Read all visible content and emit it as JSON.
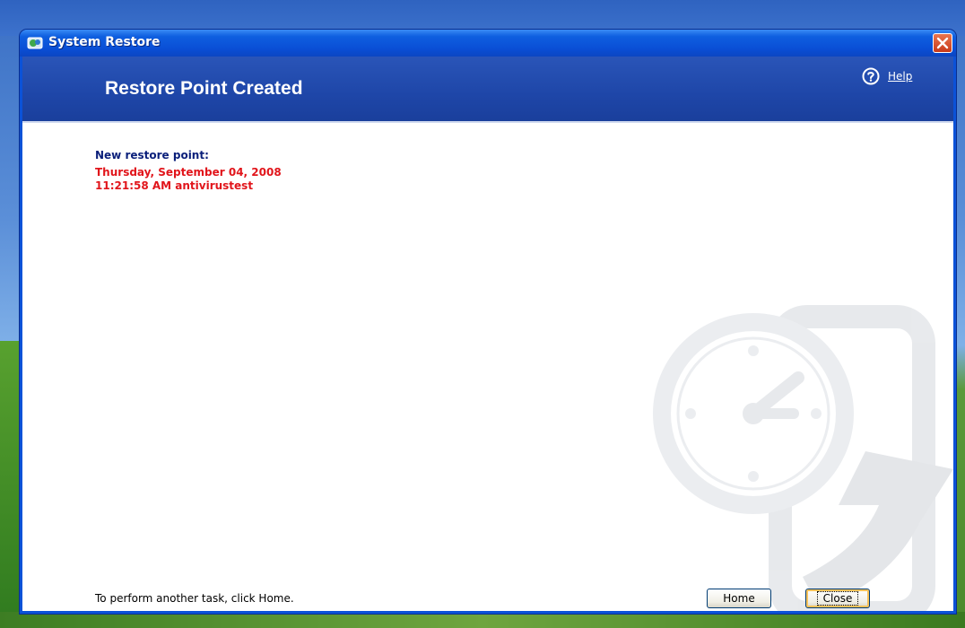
{
  "window": {
    "title": "System Restore"
  },
  "header": {
    "title": "Restore Point Created",
    "help_label": "Help"
  },
  "content": {
    "new_point_label": "New restore point:",
    "restore_date": "Thursday, September 04, 2008",
    "restore_time_desc": "11:21:58 AM  antivirustest",
    "footer_text": "To perform another task, click Home."
  },
  "buttons": {
    "home_label": "Home",
    "close_label": "Close"
  },
  "colors": {
    "accent_red": "#e1151b",
    "label_navy": "#0a1f7a",
    "header_blue": "#1e46a8"
  },
  "icons": {
    "app": "system-restore-icon",
    "help": "help-icon",
    "close": "close-icon",
    "watermark": "clock-restore-watermark-icon"
  }
}
